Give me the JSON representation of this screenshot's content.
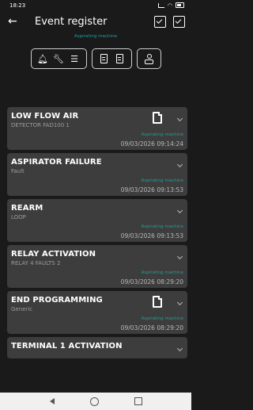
{
  "status": {
    "time": "18:23"
  },
  "header": {
    "title": "Event register",
    "subtitle": "Aspirating machine"
  },
  "events": [
    {
      "title": "LOW FLOW AIR",
      "sub": "DETECTOR FAD100 1",
      "machine": "Aspirating machine",
      "date": "09/03/2026 09:14:24",
      "note": true
    },
    {
      "title": "ASPIRATOR FAILURE",
      "sub": "Fault",
      "machine": "Aspirating machine",
      "date": "09/03/2026 09:13:53",
      "note": false
    },
    {
      "title": "REARM",
      "sub": "LOOP",
      "machine": "Aspirating machine",
      "date": "09/03/2026 09:13:53",
      "note": false
    },
    {
      "title": "RELAY ACTIVATION",
      "sub": "RELAY 4 FAULTS 2",
      "machine": "Aspirating machine",
      "date": "09/03/2026 08:29:20",
      "note": false
    },
    {
      "title": "END PROGRAMMING",
      "sub": "Generic",
      "machine": "Aspirating machine",
      "date": "09/03/2026 08:29:20",
      "note": true
    },
    {
      "title": "TERMINAL 1 ACTIVATION",
      "sub": "",
      "machine": "",
      "date": "",
      "note": false
    }
  ],
  "icons": {
    "filters": [
      "bell-icon",
      "wrench-icon",
      "checklist-icon",
      "document-icon",
      "document-edit-icon",
      "user-icon"
    ],
    "header": [
      "calendar-check-icon",
      "checkbox-icon"
    ]
  }
}
